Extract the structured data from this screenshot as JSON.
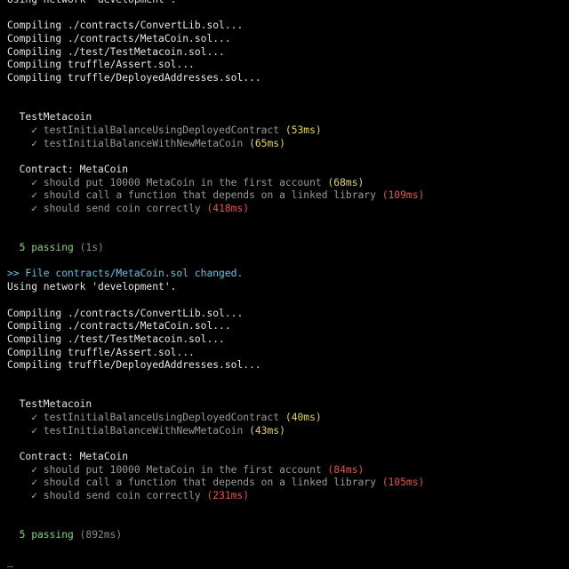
{
  "colors": {
    "background": "#000000",
    "text": "#e6e6e6",
    "dim": "#9a9a9a",
    "pass": "#7fd96a",
    "slow_medium": "#e8d44d",
    "slow": "#e6553f",
    "notice": "#5fc8e8"
  },
  "icons": {
    "check": "✓"
  },
  "lines": [
    {
      "kind": "text",
      "segments": [
        {
          "text": "Using network 'development'.",
          "color": "white"
        }
      ]
    },
    {
      "kind": "blank"
    },
    {
      "kind": "text",
      "segments": [
        {
          "text": "Compiling ./contracts/ConvertLib.sol...",
          "color": "white"
        }
      ]
    },
    {
      "kind": "text",
      "segments": [
        {
          "text": "Compiling ./contracts/MetaCoin.sol...",
          "color": "white"
        }
      ]
    },
    {
      "kind": "text",
      "segments": [
        {
          "text": "Compiling ./test/TestMetacoin.sol...",
          "color": "white"
        }
      ]
    },
    {
      "kind": "text",
      "segments": [
        {
          "text": "Compiling truffle/Assert.sol...",
          "color": "white"
        }
      ]
    },
    {
      "kind": "text",
      "segments": [
        {
          "text": "Compiling truffle/DeployedAddresses.sol...",
          "color": "white"
        }
      ]
    },
    {
      "kind": "blank"
    },
    {
      "kind": "blank"
    },
    {
      "kind": "text",
      "segments": [
        {
          "text": "  TestMetacoin",
          "color": "white"
        }
      ]
    },
    {
      "kind": "test",
      "segments": [
        {
          "text": "    ",
          "color": "white"
        },
        {
          "text": "✓",
          "color": "green",
          "icon": true
        },
        {
          "text": " testInitialBalanceUsingDeployedContract",
          "color": "dim"
        },
        {
          "text": " (53ms)",
          "color": "yellow"
        }
      ]
    },
    {
      "kind": "test",
      "segments": [
        {
          "text": "    ",
          "color": "white"
        },
        {
          "text": "✓",
          "color": "green",
          "icon": true
        },
        {
          "text": " testInitialBalanceWithNewMetaCoin",
          "color": "dim"
        },
        {
          "text": " (65ms)",
          "color": "yellow"
        }
      ]
    },
    {
      "kind": "blank"
    },
    {
      "kind": "text",
      "segments": [
        {
          "text": "  Contract: MetaCoin",
          "color": "white"
        }
      ]
    },
    {
      "kind": "test",
      "segments": [
        {
          "text": "    ",
          "color": "white"
        },
        {
          "text": "✓",
          "color": "green",
          "icon": true
        },
        {
          "text": " should put 10000 MetaCoin in the first account",
          "color": "dim"
        },
        {
          "text": " (68ms)",
          "color": "yellow"
        }
      ]
    },
    {
      "kind": "test",
      "segments": [
        {
          "text": "    ",
          "color": "white"
        },
        {
          "text": "✓",
          "color": "green",
          "icon": true
        },
        {
          "text": " should call a function that depends on a linked library",
          "color": "dim"
        },
        {
          "text": " (109ms)",
          "color": "red"
        }
      ]
    },
    {
      "kind": "test",
      "segments": [
        {
          "text": "    ",
          "color": "white"
        },
        {
          "text": "✓",
          "color": "green",
          "icon": true
        },
        {
          "text": " should send coin correctly",
          "color": "dim"
        },
        {
          "text": " (418ms)",
          "color": "red"
        }
      ]
    },
    {
      "kind": "blank"
    },
    {
      "kind": "blank"
    },
    {
      "kind": "text",
      "segments": [
        {
          "text": "  5 passing",
          "color": "green"
        },
        {
          "text": " (1s)",
          "color": "gray"
        }
      ]
    },
    {
      "kind": "blank"
    },
    {
      "kind": "text",
      "segments": [
        {
          "text": ">> File contracts/MetaCoin.sol changed.",
          "color": "cyan"
        }
      ]
    },
    {
      "kind": "text",
      "segments": [
        {
          "text": "Using network 'development'.",
          "color": "white"
        }
      ]
    },
    {
      "kind": "blank"
    },
    {
      "kind": "text",
      "segments": [
        {
          "text": "Compiling ./contracts/ConvertLib.sol...",
          "color": "white"
        }
      ]
    },
    {
      "kind": "text",
      "segments": [
        {
          "text": "Compiling ./contracts/MetaCoin.sol...",
          "color": "white"
        }
      ]
    },
    {
      "kind": "text",
      "segments": [
        {
          "text": "Compiling ./test/TestMetacoin.sol...",
          "color": "white"
        }
      ]
    },
    {
      "kind": "text",
      "segments": [
        {
          "text": "Compiling truffle/Assert.sol...",
          "color": "white"
        }
      ]
    },
    {
      "kind": "text",
      "segments": [
        {
          "text": "Compiling truffle/DeployedAddresses.sol...",
          "color": "white"
        }
      ]
    },
    {
      "kind": "blank"
    },
    {
      "kind": "blank"
    },
    {
      "kind": "text",
      "segments": [
        {
          "text": "  TestMetacoin",
          "color": "white"
        }
      ]
    },
    {
      "kind": "test",
      "segments": [
        {
          "text": "    ",
          "color": "white"
        },
        {
          "text": "✓",
          "color": "green",
          "icon": true
        },
        {
          "text": " testInitialBalanceUsingDeployedContract",
          "color": "dim"
        },
        {
          "text": " (40ms)",
          "color": "yellow"
        }
      ]
    },
    {
      "kind": "test",
      "segments": [
        {
          "text": "    ",
          "color": "white"
        },
        {
          "text": "✓",
          "color": "green",
          "icon": true
        },
        {
          "text": " testInitialBalanceWithNewMetaCoin",
          "color": "dim"
        },
        {
          "text": " (43ms)",
          "color": "yellow"
        }
      ]
    },
    {
      "kind": "blank"
    },
    {
      "kind": "text",
      "segments": [
        {
          "text": "  Contract: MetaCoin",
          "color": "white"
        }
      ]
    },
    {
      "kind": "test",
      "segments": [
        {
          "text": "    ",
          "color": "white"
        },
        {
          "text": "✓",
          "color": "green",
          "icon": true
        },
        {
          "text": " should put 10000 MetaCoin in the first account",
          "color": "dim"
        },
        {
          "text": " (84ms)",
          "color": "red"
        }
      ]
    },
    {
      "kind": "test",
      "segments": [
        {
          "text": "    ",
          "color": "white"
        },
        {
          "text": "✓",
          "color": "green",
          "icon": true
        },
        {
          "text": " should call a function that depends on a linked library",
          "color": "dim"
        },
        {
          "text": " (105ms)",
          "color": "red"
        }
      ]
    },
    {
      "kind": "test",
      "segments": [
        {
          "text": "    ",
          "color": "white"
        },
        {
          "text": "✓",
          "color": "green",
          "icon": true
        },
        {
          "text": " should send coin correctly",
          "color": "dim"
        },
        {
          "text": " (231ms)",
          "color": "red"
        }
      ]
    },
    {
      "kind": "blank"
    },
    {
      "kind": "blank"
    },
    {
      "kind": "text",
      "segments": [
        {
          "text": "  5 passing",
          "color": "green"
        },
        {
          "text": " (892ms)",
          "color": "gray"
        }
      ]
    },
    {
      "kind": "blank"
    },
    {
      "kind": "text",
      "segments": [
        {
          "text": "_",
          "color": "white"
        }
      ]
    }
  ]
}
